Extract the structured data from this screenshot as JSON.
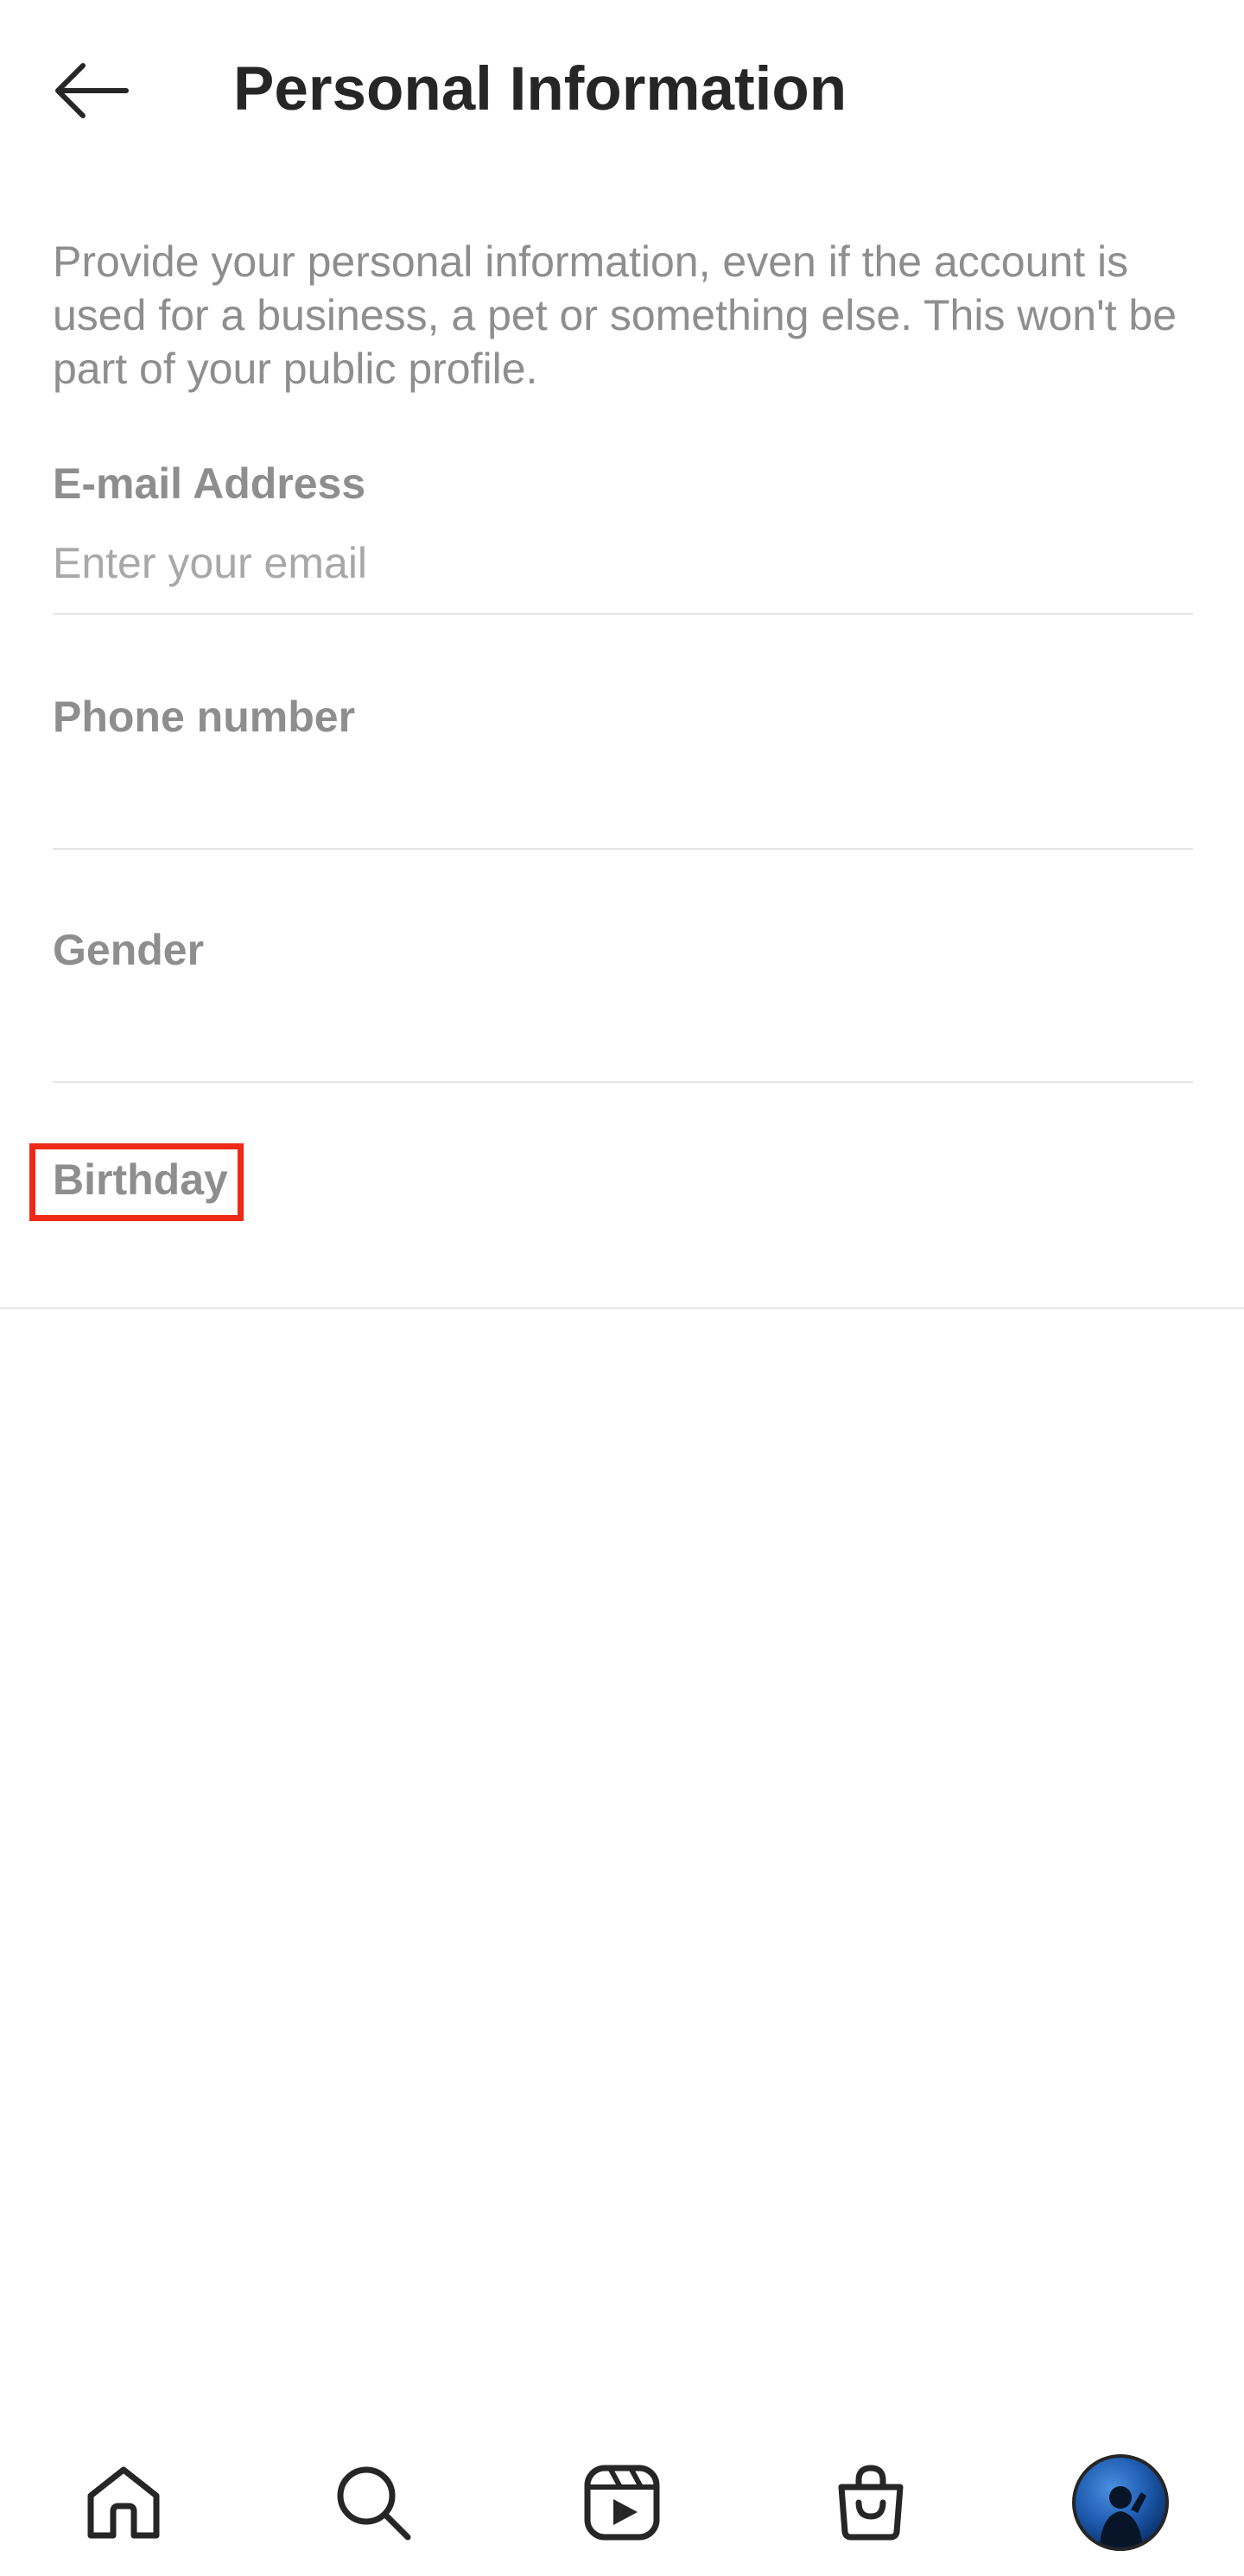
{
  "header": {
    "title": "Personal Information",
    "back_icon": "arrow-left-icon"
  },
  "description": "Provide your personal information, even if the account is used for a business, a pet or something else. This won't be part of your public profile.",
  "fields": {
    "email": {
      "label": "E-mail Address",
      "placeholder": "Enter your email",
      "value": ""
    },
    "phone": {
      "label": "Phone number",
      "value": ""
    },
    "gender": {
      "label": "Gender",
      "value": ""
    },
    "birthday": {
      "label": "Birthday"
    }
  },
  "highlight": {
    "target": "birthday-label",
    "color": "#ee2a17"
  },
  "bottom_nav": {
    "items": [
      {
        "name": "home",
        "icon": "home-icon"
      },
      {
        "name": "search",
        "icon": "search-icon"
      },
      {
        "name": "reels",
        "icon": "reels-icon"
      },
      {
        "name": "shop",
        "icon": "shopping-bag-icon"
      },
      {
        "name": "profile",
        "icon": "avatar"
      }
    ]
  },
  "colors": {
    "text_primary": "#262626",
    "text_secondary": "#8e8e8e",
    "divider": "#e6e6e6",
    "background": "#ffffff"
  }
}
